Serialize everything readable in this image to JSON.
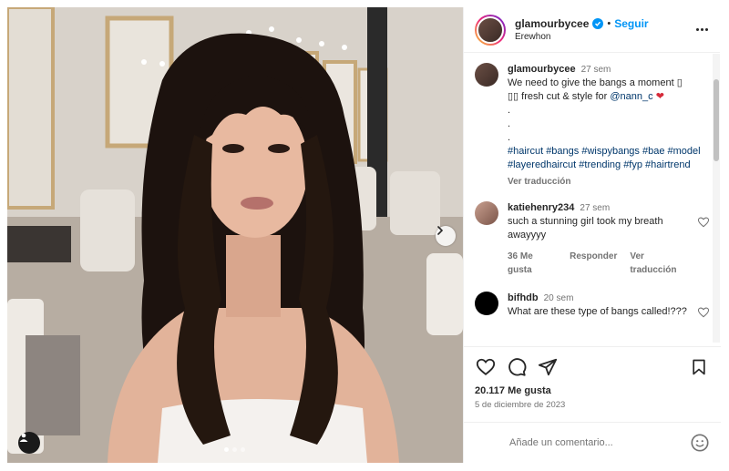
{
  "post": {
    "author": {
      "username": "glamourbycee",
      "verified": true,
      "follow_label": "Seguir",
      "separator": "•",
      "location": "Erewhon"
    },
    "caption": {
      "username": "glamourbycee",
      "time": "27 sem",
      "text_line1": "We need to give the bangs a moment ",
      "glyph1": "▯",
      "text_line2_glyphs": "▯▯",
      "text_line2": " fresh cut & style for ",
      "mention": "@nann_c",
      "heart": "❤",
      "dots": [
        ".",
        ".",
        "."
      ],
      "hashtags": "#haircut #bangs #wispybangs #bae #model #layeredhaircut #trending #fyp #hairtrend",
      "translate_label": "Ver traducción"
    },
    "comments": [
      {
        "username": "katiehenry234",
        "time": "27 sem",
        "text": "such a stunning girl took my breath awayyyy",
        "likes_label": "36 Me gusta",
        "reply_label": "Responder",
        "translate_label": "Ver traducción"
      },
      {
        "username": "bifhdb",
        "time": "20 sem",
        "text": "What are these type of bangs called!???"
      }
    ],
    "likes": "20.117 Me gusta",
    "date": "5 de diciembre de 2023",
    "add_comment_placeholder": "Añade un comentario...",
    "icons": {
      "like": "heart-outline-icon",
      "comment": "comment-bubble-icon",
      "share": "paper-plane-icon",
      "save": "bookmark-icon",
      "emoji": "smiley-face-icon",
      "more": "more-options-icon",
      "next": "chevron-right-icon",
      "tag": "user-tag-icon"
    },
    "carousel": {
      "total": 3,
      "active_index": 1
    }
  },
  "colors": {
    "accent": "#0095f6",
    "link": "#00376b",
    "muted": "#737373",
    "text": "#262626",
    "border": "#efefef"
  }
}
